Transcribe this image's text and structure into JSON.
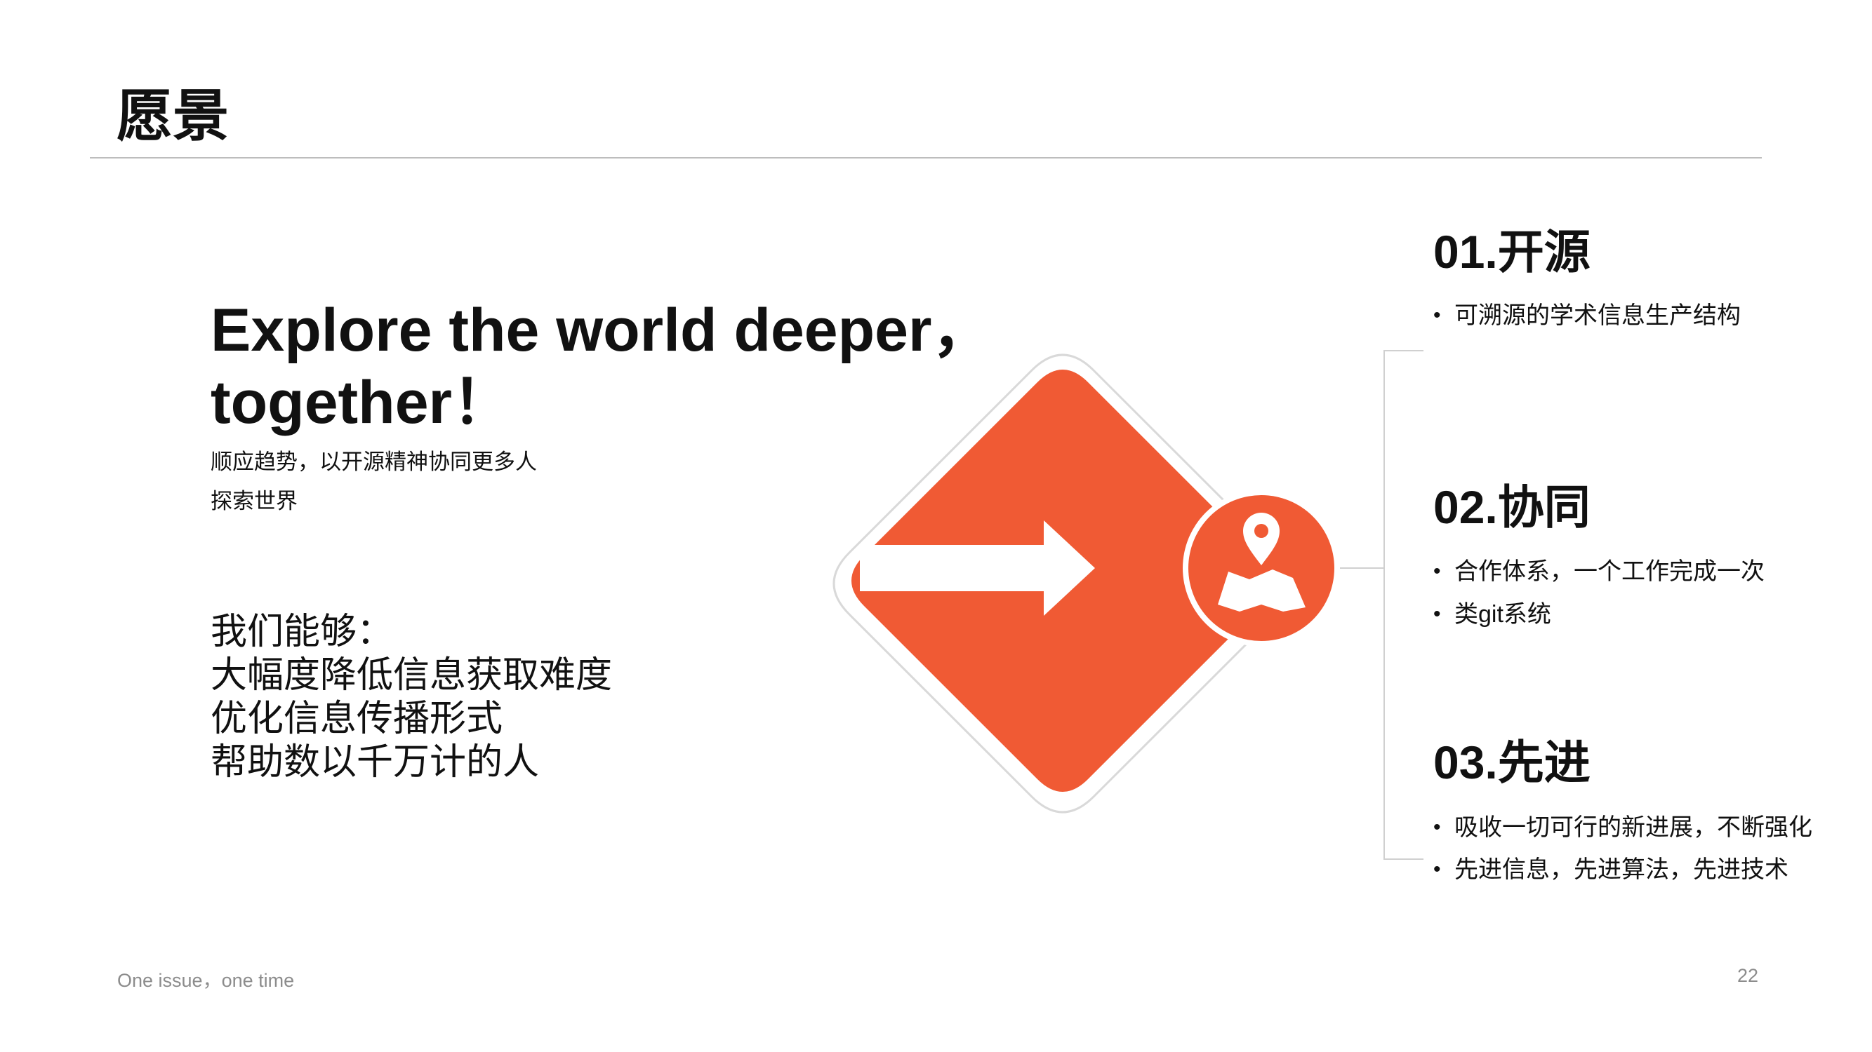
{
  "slide": {
    "title": "愿景",
    "headline_line1": "Explore the world deeper，",
    "headline_line2": "together！",
    "subtitle_line1": "顺应趋势，以开源精神协同更多人",
    "subtitle_line2": "探索世界",
    "capabilities_intro": "我们能够：",
    "capabilities": [
      "大幅度降低信息获取难度",
      "优化信息传播形式",
      "帮助数以千万计的人"
    ]
  },
  "sections": [
    {
      "title": "01.开源",
      "bullets": [
        "可溯源的学术信息生产结构"
      ]
    },
    {
      "title": "02.协同",
      "bullets": [
        "合作体系，一个工作完成一次",
        "类git系统"
      ]
    },
    {
      "title": "03.先进",
      "bullets": [
        "吸收一切可行的新进展，不断强化",
        "先进信息，先进算法，先进技术"
      ]
    }
  ],
  "footer": {
    "tagline": "One issue，one time",
    "page_number": "22"
  },
  "colors": {
    "accent": "#f05a34",
    "text": "#111111",
    "muted": "#8c8c8c",
    "rule": "#bdbdbd"
  },
  "icons": [
    "arrow-right-icon",
    "map-pin-icon"
  ]
}
